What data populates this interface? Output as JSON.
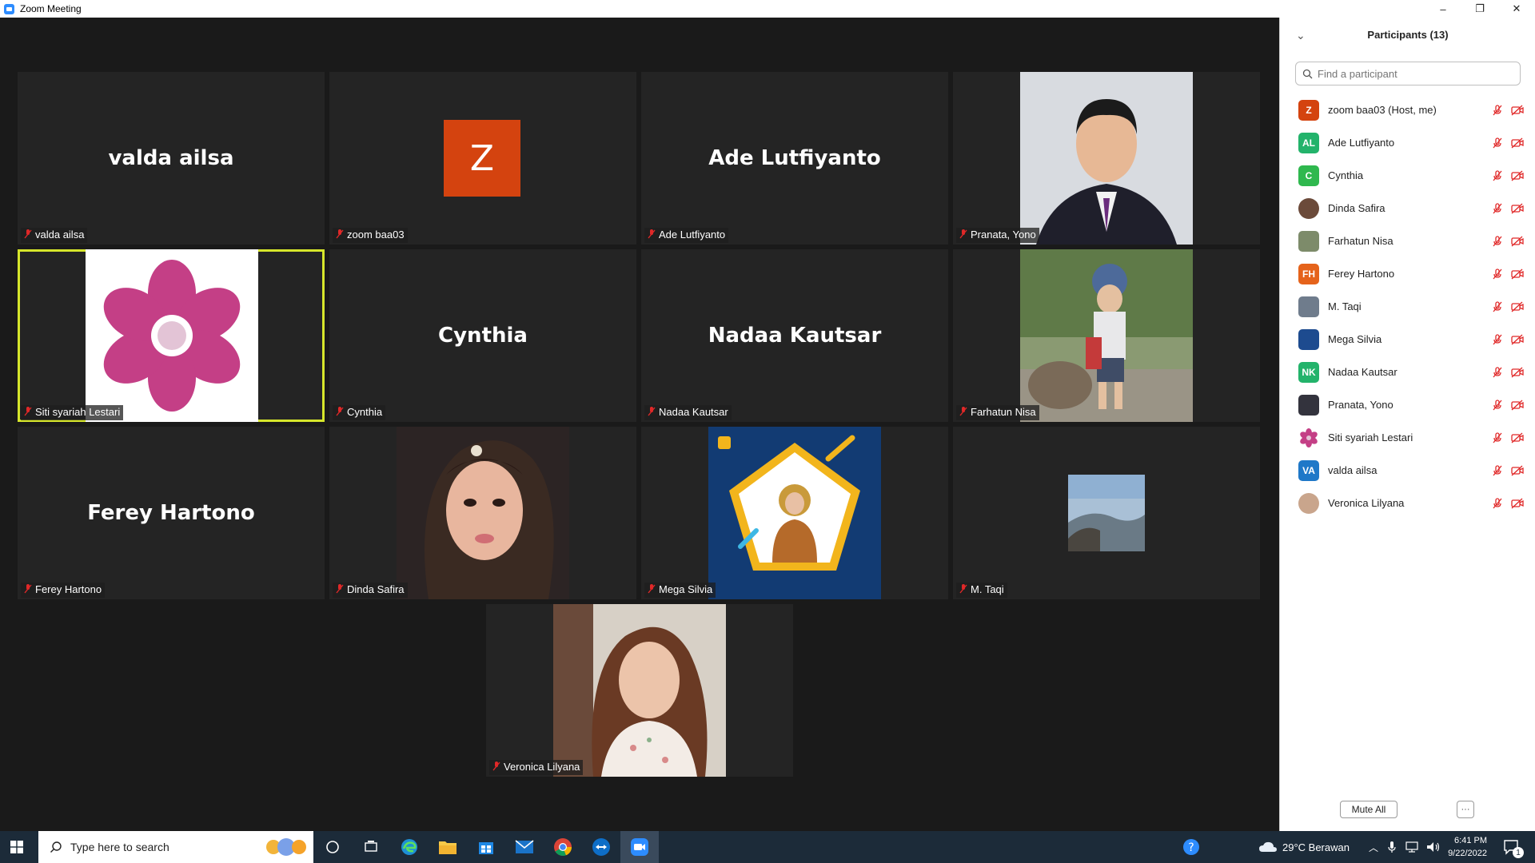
{
  "window": {
    "title": "Zoom Meeting",
    "minimize": "–",
    "restore": "❐",
    "close": "✕"
  },
  "tiles": [
    {
      "name": "valda ailsa",
      "display": "valda ailsa"
    },
    {
      "name": "zoom baa03",
      "initial": "Z"
    },
    {
      "name": "Ade Lutfiyanto",
      "display": "Ade Lutfiyanto"
    },
    {
      "name": "Pranata, Yono"
    },
    {
      "name": "Siti syariah Lestari"
    },
    {
      "name": "Cynthia",
      "display": "Cynthia"
    },
    {
      "name": "Nadaa Kautsar",
      "display": "Nadaa Kautsar"
    },
    {
      "name": "Farhatun Nisa"
    },
    {
      "name": "Ferey Hartono",
      "display": "Ferey Hartono"
    },
    {
      "name": "Dinda Safira"
    },
    {
      "name": "Mega Silvia"
    },
    {
      "name": "M. Taqi"
    },
    {
      "name": "Veronica Lilyana"
    }
  ],
  "participants_panel": {
    "title": "Participants (13)",
    "search_placeholder": "Find a participant",
    "participants": [
      {
        "name": "zoom baa03 (Host, me)",
        "avatar_text": "Z",
        "avatar_color": "#d4430f"
      },
      {
        "name": "Ade Lutfiyanto",
        "avatar_text": "AL",
        "avatar_color": "#23b36b"
      },
      {
        "name": "Cynthia",
        "avatar_text": "C",
        "avatar_color": "#2fb84e"
      },
      {
        "name": "Dinda Safira",
        "avatar_text": "",
        "avatar_color": "#6b4a3a"
      },
      {
        "name": "Farhatun Nisa",
        "avatar_text": "",
        "avatar_color": "#7d8b6a"
      },
      {
        "name": "Ferey Hartono",
        "avatar_text": "FH",
        "avatar_color": "#e5631b"
      },
      {
        "name": "M. Taqi",
        "avatar_text": "",
        "avatar_color": "#6f7c8c"
      },
      {
        "name": "Mega Silvia",
        "avatar_text": "",
        "avatar_color": "#1d4b8f"
      },
      {
        "name": "Nadaa Kautsar",
        "avatar_text": "NK",
        "avatar_color": "#23b36b"
      },
      {
        "name": "Pranata, Yono",
        "avatar_text": "",
        "avatar_color": "#33333d"
      },
      {
        "name": "Siti syariah Lestari",
        "avatar_text": "",
        "avatar_color": "#ffffff"
      },
      {
        "name": "valda ailsa",
        "avatar_text": "VA",
        "avatar_color": "#1f78c8"
      },
      {
        "name": "Veronica Lilyana",
        "avatar_text": "",
        "avatar_color": "#c9a58c"
      }
    ],
    "mute_all_label": "Mute All",
    "more_label": "···"
  },
  "taskbar": {
    "search_placeholder": "Type here to search",
    "weather": "29°C  Berawan",
    "time": "6:41 PM",
    "date": "9/22/2022",
    "notification_count": "1"
  }
}
